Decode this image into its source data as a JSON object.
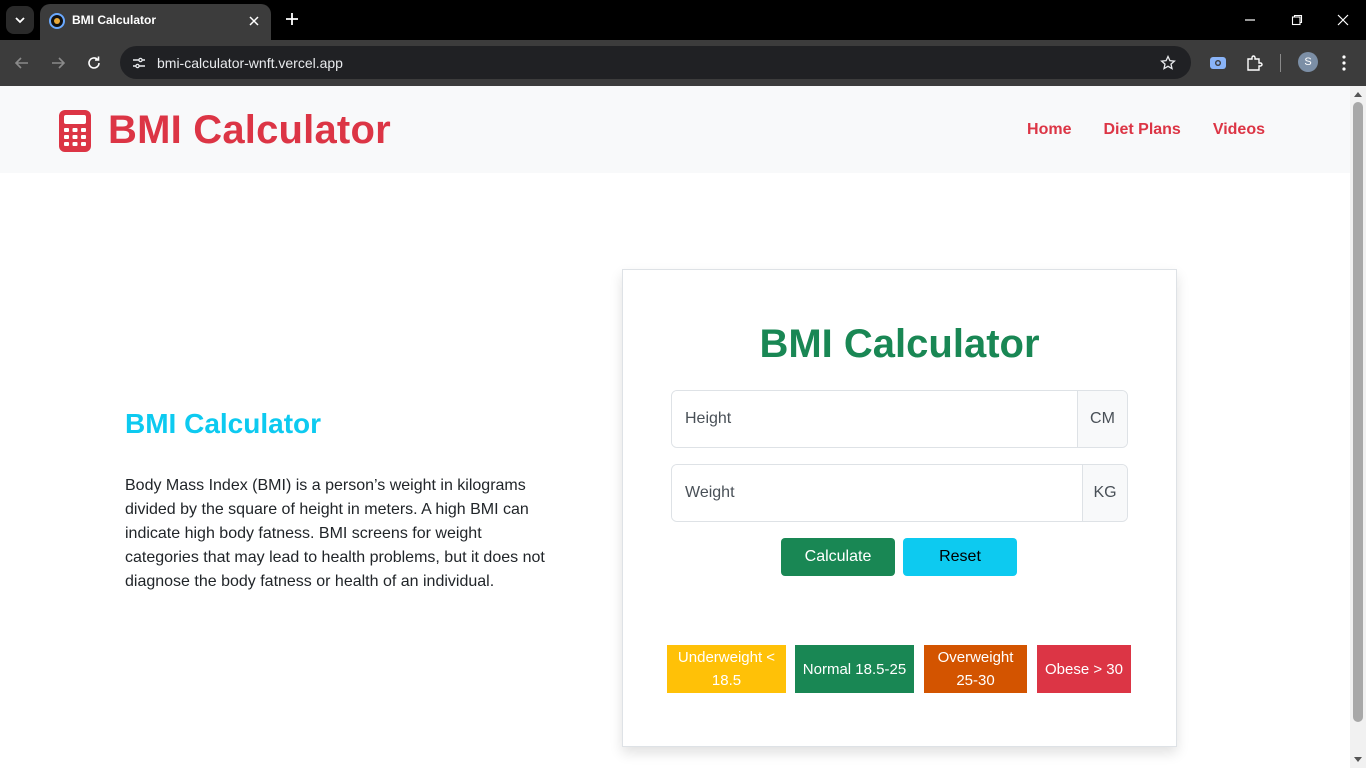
{
  "browser": {
    "tab_title": "BMI Calculator",
    "url": "bmi-calculator-wnft.vercel.app",
    "profile_initial": "S"
  },
  "site": {
    "brand": "BMI Calculator",
    "nav": [
      "Home",
      "Diet Plans",
      "Videos"
    ]
  },
  "info": {
    "title": "BMI Calculator",
    "text": "Body Mass Index (BMI) is a person’s weight in kilograms divided by the square of height in meters. A high BMI can indicate high body fatness. BMI screens for weight categories that may lead to health problems, but it does not diagnose the body fatness or health of an individual."
  },
  "calculator": {
    "title": "BMI Calculator",
    "height_placeholder": "Height",
    "height_unit": "CM",
    "weight_placeholder": "Weight",
    "weight_unit": "KG",
    "calculate_label": "Calculate",
    "reset_label": "Reset"
  },
  "categories": [
    {
      "label": "Underweight < 18.5",
      "color": "#ffc107"
    },
    {
      "label": "Normal 18.5-25",
      "color": "#198754"
    },
    {
      "label": "Overweight 25-30",
      "color": "#d35400"
    },
    {
      "label": "Obese > 30",
      "color": "#dc3545"
    }
  ]
}
